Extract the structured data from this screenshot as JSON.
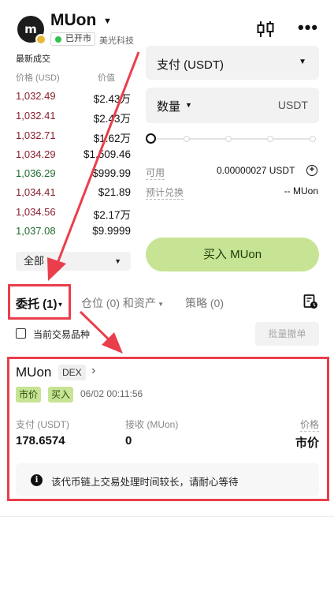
{
  "header": {
    "logo_letter": "m",
    "symbol": "MUon",
    "status": "已开市",
    "company": "美光科技",
    "chart_icon": "candlestick-icon",
    "more_icon": "more-icon",
    "more_glyph": "•••"
  },
  "trades": {
    "title": "最新成交",
    "col_price": "价格 (USD)",
    "col_value": "价值",
    "rows": [
      {
        "price": "1,032.49",
        "value": "$2.43万",
        "side": "sell"
      },
      {
        "price": "1,032.41",
        "value": "$2.43万",
        "side": "sell"
      },
      {
        "price": "1,032.71",
        "value": "$1.62万",
        "side": "sell"
      },
      {
        "price": "1,034.29",
        "value": "$1,509.46",
        "side": "sell"
      },
      {
        "price": "1,036.29",
        "value": "$999.99",
        "side": "buy"
      },
      {
        "price": "1,034.41",
        "value": "$21.89",
        "side": "sell"
      },
      {
        "price": "1,034.56",
        "value": "$2.17万",
        "side": "sell"
      },
      {
        "price": "1,037.08",
        "value": "$9.9999",
        "side": "buy"
      }
    ],
    "filter": "全部"
  },
  "order": {
    "pay_select": "支付 (USDT)",
    "qty_label": "数量",
    "qty_unit": "USDT",
    "slider_fraction": 0,
    "available_label": "可用",
    "available_value": "0.00000027 USDT",
    "estimate_label": "预计兑换",
    "estimate_value": "-- MUon",
    "buy_button": "买入 MUon"
  },
  "tabs": {
    "orders": "委托 (1)",
    "positions": "仓位 (0) 和资产",
    "strategy": "策略 (0)"
  },
  "filters": {
    "current_only": "当前交易品种",
    "batch_cancel": "批量撤单"
  },
  "card": {
    "symbol": "MUon",
    "tag": "DEX",
    "arrow": "›",
    "order_type": "市价",
    "side": "买入",
    "time": "06/02 00:11:56",
    "pay_label": "支付 (USDT)",
    "pay_value": "178.6574",
    "receive_label": "接收 (MUon)",
    "receive_value": "0",
    "price_label": "价格",
    "price_value": "市价",
    "notice_icon": "i",
    "notice": "该代币链上交易处理时间较长，请耐心等待"
  },
  "colors": {
    "sell": "#8a1f2d",
    "buy": "#1e6b2c",
    "accent_green": "#c6e493",
    "annotation_red": "#ea3e4c"
  }
}
